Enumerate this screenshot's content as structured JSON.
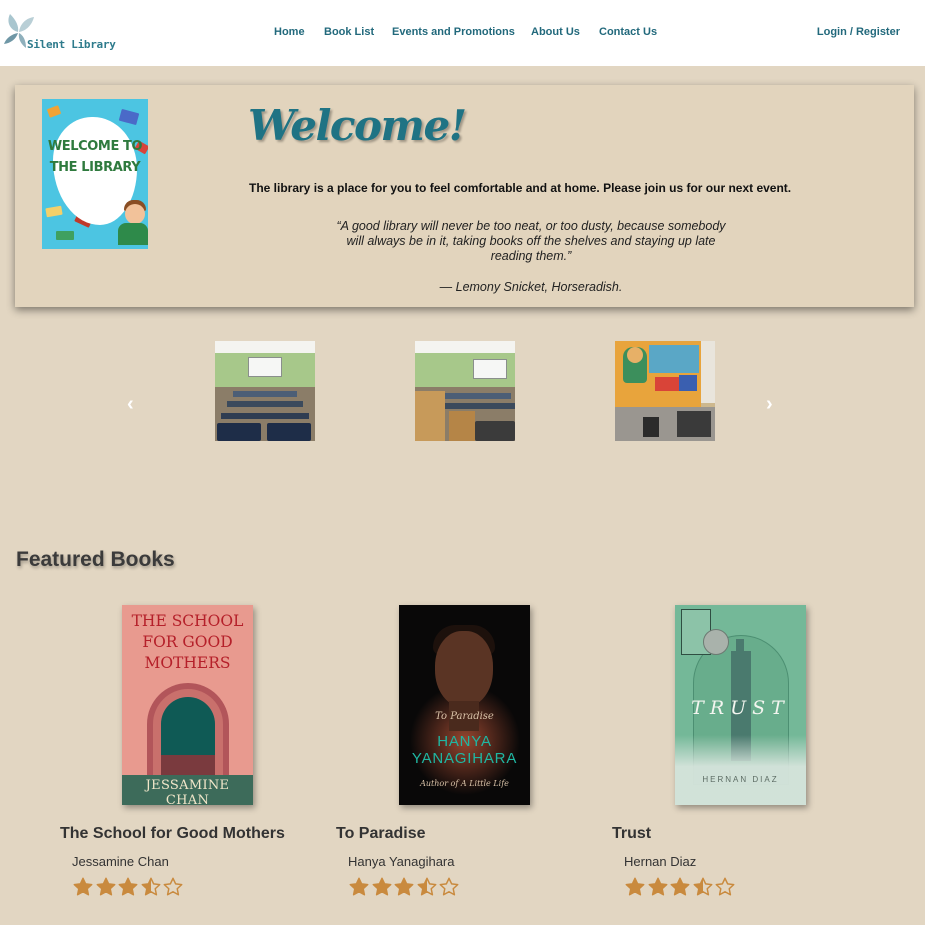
{
  "header": {
    "logo_text": "Silent Library",
    "nav": [
      "Home",
      "Book List",
      "Events and Promotions",
      "About Us",
      "Contact Us"
    ],
    "login_label": "Login / Register"
  },
  "welcome": {
    "poster_text": "WELCOME TO THE LIBRARY",
    "title": "Welcome!",
    "subtitle": "The library is a place for you to feel comfortable and at home. Please join us for our next event.",
    "quote": "“A good library will never be too neat, or too dusty, because somebody will always be in it, taking books off the shelves and staying up late reading them.”",
    "attribution": "— Lemony Snicket, Horseradish."
  },
  "carousel": {
    "prev_icon": "chevron-left-icon",
    "next_icon": "chevron-right-icon",
    "prev_glyph": "‹",
    "next_glyph": "›",
    "slides": [
      "classroom-photo",
      "classroom-photo",
      "mural-reading-area-photo"
    ]
  },
  "featured": {
    "heading": "Featured Books",
    "books": [
      {
        "title": "The School for Good Mothers",
        "author": "Jessamine Chan",
        "rating": 3.5,
        "max_rating": 5,
        "cover_title": "THE SCHOOL FOR GOOD MOTHERS",
        "cover_author": "JESSAMINE CHAN"
      },
      {
        "title": "To Paradise",
        "author": "Hanya Yanagihara",
        "rating": 3.5,
        "max_rating": 5,
        "cover_title": "To Paradise",
        "cover_author": "HANYA YANAGIHARA",
        "cover_tagline": "Author of A Little Life"
      },
      {
        "title": "Trust",
        "author": "Hernan Diaz",
        "rating": 3.5,
        "max_rating": 5,
        "cover_title": "TRUST",
        "cover_author": "HERNAN DIAZ"
      }
    ]
  },
  "colors": {
    "background": "#e2d6c2",
    "header": "#ffffff",
    "nav_text": "#22697c",
    "welcome_title": "#1f7384",
    "star": "#c98a3e"
  }
}
